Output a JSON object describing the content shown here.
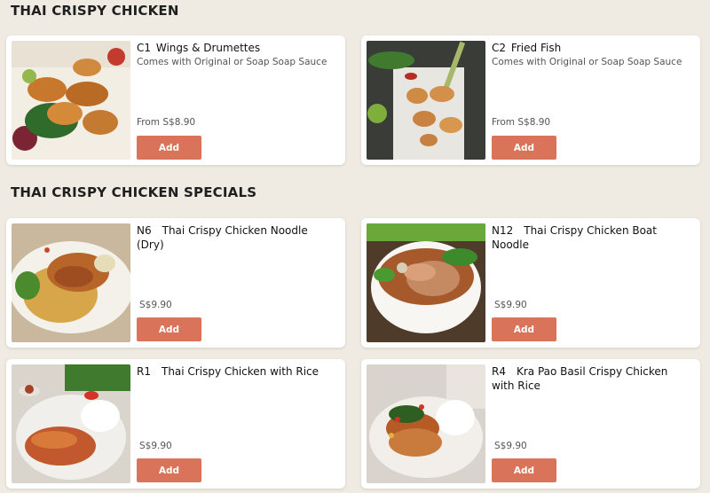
{
  "sections": [
    {
      "title": "THAI CRISPY CHICKEN",
      "items": [
        {
          "code": "C1",
          "name": "Wings & Drumettes",
          "description": "Comes with Original or Soap Soap Sauce",
          "price": "From S$8.90",
          "button": "Add",
          "image_icon": "fried-wings-photo"
        },
        {
          "code": "C2",
          "name": "Fried Fish",
          "description": "Comes with Original or Soap Soap Sauce",
          "price": "From S$8.90",
          "button": "Add",
          "image_icon": "fried-fish-photo"
        }
      ]
    },
    {
      "title": "THAI CRISPY CHICKEN SPECIALS",
      "items": [
        {
          "code": "N6",
          "name": "Thai Crispy Chicken Noodle (Dry)",
          "price": "S$9.90",
          "button": "Add",
          "image_icon": "chicken-noodle-photo"
        },
        {
          "code": "N12",
          "name": "Thai Crispy Chicken Boat Noodle",
          "price": "S$9.90",
          "button": "Add",
          "image_icon": "boat-noodle-photo"
        },
        {
          "code": "R1",
          "name": "Thai Crispy Chicken with Rice",
          "price": "S$9.90",
          "button": "Add",
          "image_icon": "chicken-rice-photo"
        },
        {
          "code": "R4",
          "name": "Kra Pao Basil Crispy Chicken with Rice",
          "price": "S$9.90",
          "button": "Add",
          "image_icon": "basil-chicken-rice-photo"
        }
      ]
    }
  ],
  "colors": {
    "background": "#efebe3",
    "button": "#d9745a",
    "card": "#ffffff"
  }
}
